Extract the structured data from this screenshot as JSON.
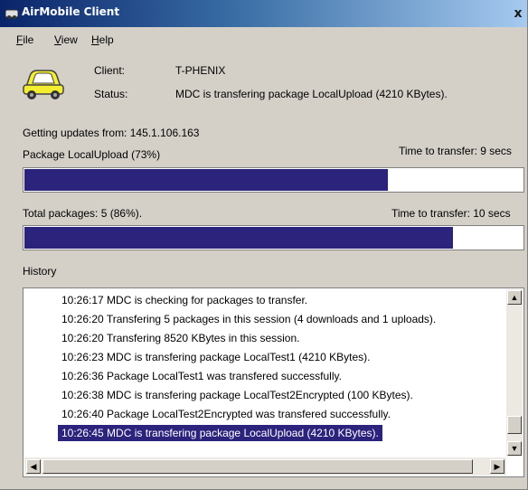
{
  "window": {
    "title": "AirMobile Client",
    "close_glyph": "x"
  },
  "menu": [
    {
      "mnemonic": "F",
      "rest": "ile"
    },
    {
      "mnemonic": "V",
      "rest": "iew"
    },
    {
      "mnemonic": "H",
      "rest": "elp"
    }
  ],
  "client": {
    "label": "Client:",
    "value": "T-PHENIX"
  },
  "status": {
    "label": "Status:",
    "value": "MDC is transfering package LocalUpload (4210 KBytes)."
  },
  "updates": {
    "text": "Getting updates from:  145.1.106.163"
  },
  "package": {
    "label": "Package LocalUpload (73%)",
    "time": "Time to transfer: 9 secs",
    "progress": 0.73
  },
  "total": {
    "label": "Total packages: 5 (86%).",
    "time": "Time to transfer: 10 secs",
    "progress": 0.86
  },
  "history": {
    "label": "History",
    "lines": [
      "10:26:17 MDC is checking for packages to transfer.",
      "10:26:20 Transfering 5 packages in this session (4 downloads and 1 uploads).",
      "10:26:20 Transfering 8520 KBytes in this session.",
      "10:26:23 MDC is transfering package LocalTest1 (4210 KBytes).",
      "10:26:36 Package LocalTest1 was transfered successfully.",
      "10:26:38 MDC is transfering package LocalTest2Encrypted (100 KBytes).",
      "10:26:40 Package LocalTest2Encrypted was transfered successfully.",
      "10:26:45 MDC is transfering package LocalUpload (4210 KBytes)."
    ],
    "selected_index": 7
  },
  "icons": {
    "app": "app-icon",
    "car": "car-icon"
  },
  "colors": {
    "progress_fill": "#2b237c",
    "selection": "#2b237c"
  }
}
